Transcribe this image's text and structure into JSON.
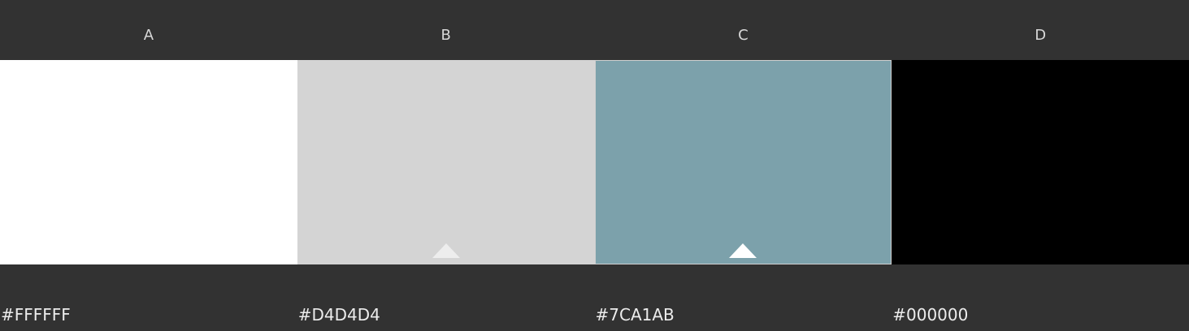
{
  "palette": {
    "colors": [
      {
        "label": "A",
        "hex": "#FFFFFF",
        "fill": "#FFFFFF",
        "marker": null,
        "selected": false
      },
      {
        "label": "B",
        "hex": "#D4D4D4",
        "fill": "#D4D4D4",
        "marker": "#EDEDED",
        "selected": false
      },
      {
        "label": "C",
        "hex": "#7CA1AB",
        "fill": "#7CA1AB",
        "marker": "#FFFFFF",
        "selected": true
      },
      {
        "label": "D",
        "hex": "#000000",
        "fill": "#000000",
        "marker": null,
        "selected": false
      }
    ]
  }
}
